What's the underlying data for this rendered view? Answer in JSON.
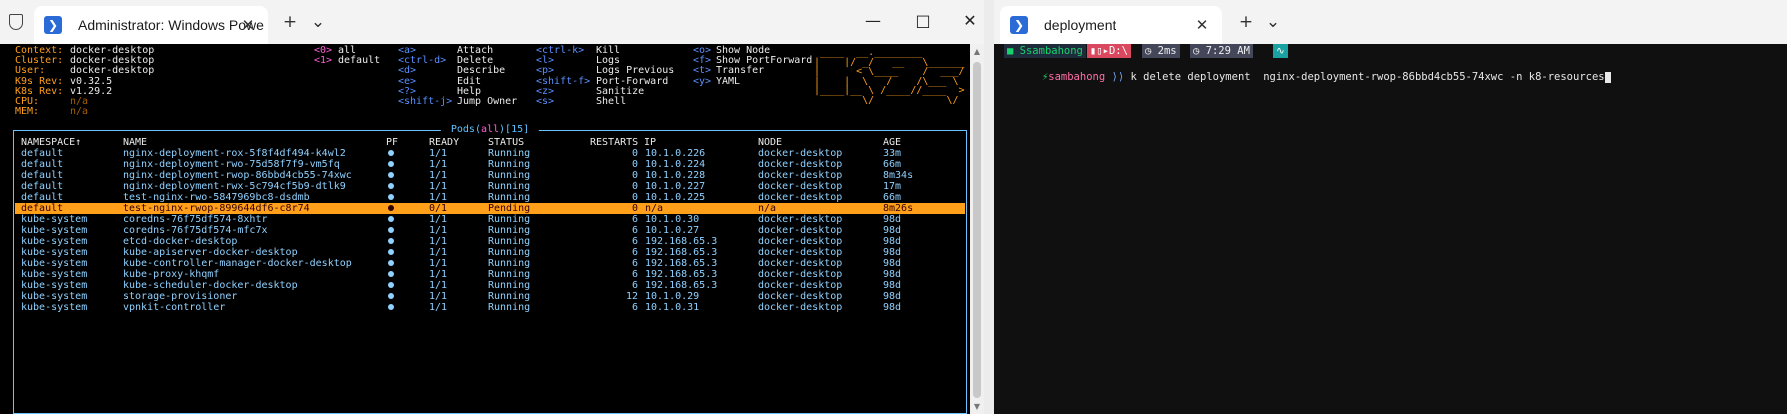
{
  "left_window": {
    "tab_title": "Administrator: Windows Powe",
    "new_tab": "+",
    "dropdown": "⌄",
    "minimize": "—",
    "maximize": "□",
    "close": "✕"
  },
  "right_window": {
    "tab_title": "deployment",
    "new_tab": "+",
    "dropdown": "⌄"
  },
  "k9s": {
    "info": [
      {
        "key": "Context:",
        "value": "docker-desktop"
      },
      {
        "key": "Cluster:",
        "value": "docker-desktop"
      },
      {
        "key": "User:",
        "value": "docker-desktop"
      },
      {
        "key": "K9s Rev:",
        "value": "v0.32.5"
      },
      {
        "key": "K8s Rev:",
        "value": "v1.29.2"
      },
      {
        "key": "CPU:",
        "value": "n/a"
      },
      {
        "key": "MEM:",
        "value": "n/a"
      }
    ],
    "namespaces": [
      {
        "key": "<0>",
        "label": "all"
      },
      {
        "key": "<1>",
        "label": "default"
      }
    ],
    "shortcuts_col1": [
      {
        "key": "<a>",
        "label": "Attach"
      },
      {
        "key": "<ctrl-d>",
        "label": "Delete"
      },
      {
        "key": "<d>",
        "label": "Describe"
      },
      {
        "key": "<e>",
        "label": "Edit"
      },
      {
        "key": "<?>",
        "label": "Help"
      },
      {
        "key": "<shift-j>",
        "label": "Jump Owner"
      }
    ],
    "shortcuts_col2": [
      {
        "key": "<ctrl-k>",
        "label": "Kill"
      },
      {
        "key": "<l>",
        "label": "Logs"
      },
      {
        "key": "<p>",
        "label": "Logs Previous"
      },
      {
        "key": "<shift-f>",
        "label": "Port-Forward"
      },
      {
        "key": "<z>",
        "label": "Sanitize"
      },
      {
        "key": "<s>",
        "label": "Shell"
      }
    ],
    "shortcuts_col3": [
      {
        "key": "<o>",
        "label": "Show Node"
      },
      {
        "key": "<f>",
        "label": "Show PortForward"
      },
      {
        "key": "<t>",
        "label": "Transfer"
      },
      {
        "key": "<y>",
        "label": "YAML"
      }
    ],
    "logo_lines": [
      " ____  __.________       ",
      "|    |/ _/   __   \\______",
      "|      < \\____    /  ___/",
      "|    |  \\   /    /\\___ \\ ",
      "|____|__ \\ /____//____  >",
      "        \\/            \\/ "
    ],
    "pods_title": {
      "prefix": " Pods(",
      "filter": "all",
      "suffix": ")[15] "
    },
    "columns": {
      "namespace": "NAMESPACE↑",
      "name": "NAME",
      "pf": "PF",
      "ready": "READY",
      "status": "STATUS",
      "restarts": "RESTARTS",
      "ip": "IP",
      "node": "NODE",
      "age": "AGE"
    },
    "rows": [
      {
        "namespace": "default",
        "name": "nginx-deployment-rox-5f8f4df494-k4wl2",
        "ready": "1/1",
        "status": "Running",
        "restarts": "0",
        "ip": "10.1.0.226",
        "node": "docker-desktop",
        "age": "33m"
      },
      {
        "namespace": "default",
        "name": "nginx-deployment-rwo-75d58f7f9-vm5fq",
        "ready": "1/1",
        "status": "Running",
        "restarts": "0",
        "ip": "10.1.0.224",
        "node": "docker-desktop",
        "age": "66m"
      },
      {
        "namespace": "default",
        "name": "nginx-deployment-rwop-86bbd4cb55-74xwc",
        "ready": "1/1",
        "status": "Running",
        "restarts": "0",
        "ip": "10.1.0.228",
        "node": "docker-desktop",
        "age": "8m34s"
      },
      {
        "namespace": "default",
        "name": "nginx-deployment-rwx-5c794cf5b9-dtlk9",
        "ready": "1/1",
        "status": "Running",
        "restarts": "0",
        "ip": "10.1.0.227",
        "node": "docker-desktop",
        "age": "17m"
      },
      {
        "namespace": "default",
        "name": "test-nginx-rwo-5847969bc8-dsdmb",
        "ready": "1/1",
        "status": "Running",
        "restarts": "0",
        "ip": "10.1.0.225",
        "node": "docker-desktop",
        "age": "66m"
      },
      {
        "namespace": "default",
        "name": "test-nginx-rwop-899644df6-c8r74",
        "ready": "0/1",
        "status": "Pending",
        "restarts": "0",
        "ip": "n/a",
        "node": "n/a",
        "age": "8m26s",
        "selected": true
      },
      {
        "namespace": "kube-system",
        "name": "coredns-76f75df574-8xhtr",
        "ready": "1/1",
        "status": "Running",
        "restarts": "6",
        "ip": "10.1.0.30",
        "node": "docker-desktop",
        "age": "98d"
      },
      {
        "namespace": "kube-system",
        "name": "coredns-76f75df574-mfc7x",
        "ready": "1/1",
        "status": "Running",
        "restarts": "6",
        "ip": "10.1.0.27",
        "node": "docker-desktop",
        "age": "98d"
      },
      {
        "namespace": "kube-system",
        "name": "etcd-docker-desktop",
        "ready": "1/1",
        "status": "Running",
        "restarts": "6",
        "ip": "192.168.65.3",
        "node": "docker-desktop",
        "age": "98d"
      },
      {
        "namespace": "kube-system",
        "name": "kube-apiserver-docker-desktop",
        "ready": "1/1",
        "status": "Running",
        "restarts": "6",
        "ip": "192.168.65.3",
        "node": "docker-desktop",
        "age": "98d"
      },
      {
        "namespace": "kube-system",
        "name": "kube-controller-manager-docker-desktop",
        "ready": "1/1",
        "status": "Running",
        "restarts": "6",
        "ip": "192.168.65.3",
        "node": "docker-desktop",
        "age": "98d"
      },
      {
        "namespace": "kube-system",
        "name": "kube-proxy-khqmf",
        "ready": "1/1",
        "status": "Running",
        "restarts": "6",
        "ip": "192.168.65.3",
        "node": "docker-desktop",
        "age": "98d"
      },
      {
        "namespace": "kube-system",
        "name": "kube-scheduler-docker-desktop",
        "ready": "1/1",
        "status": "Running",
        "restarts": "6",
        "ip": "192.168.65.3",
        "node": "docker-desktop",
        "age": "98d"
      },
      {
        "namespace": "kube-system",
        "name": "storage-provisioner",
        "ready": "1/1",
        "status": "Running",
        "restarts": "12",
        "ip": "10.1.0.29",
        "node": "docker-desktop",
        "age": "98d"
      },
      {
        "namespace": "kube-system",
        "name": "vpnkit-controller",
        "ready": "1/1",
        "status": "Running",
        "restarts": "6",
        "ip": "10.1.0.31",
        "node": "docker-desktop",
        "age": "98d"
      }
    ]
  },
  "prompt": {
    "user_segment": "Ssambahong",
    "path_segment": "D:\\",
    "duration_segment": "2ms",
    "time_segment": "7:29 AM",
    "line2_user": "sambahong",
    "line2_arrows": "⟩⟩",
    "command": "k delete deployment  nginx-deployment-rwop-86bbd4cb55-74xwc -n k8-resources",
    "colors": {
      "user_bg": "#1e2b3a",
      "path_bg": "#d9485f",
      "time_bg": "#44475a",
      "accent": "#18d26e"
    }
  },
  "colors": {
    "k9s_orange": "#ff9f1a",
    "k9s_cyan": "#5ec2ff",
    "k9s_magenta": "#ff5fd7",
    "k9s_blue": "#5a8fff",
    "row_text": "#8fd1ff"
  }
}
